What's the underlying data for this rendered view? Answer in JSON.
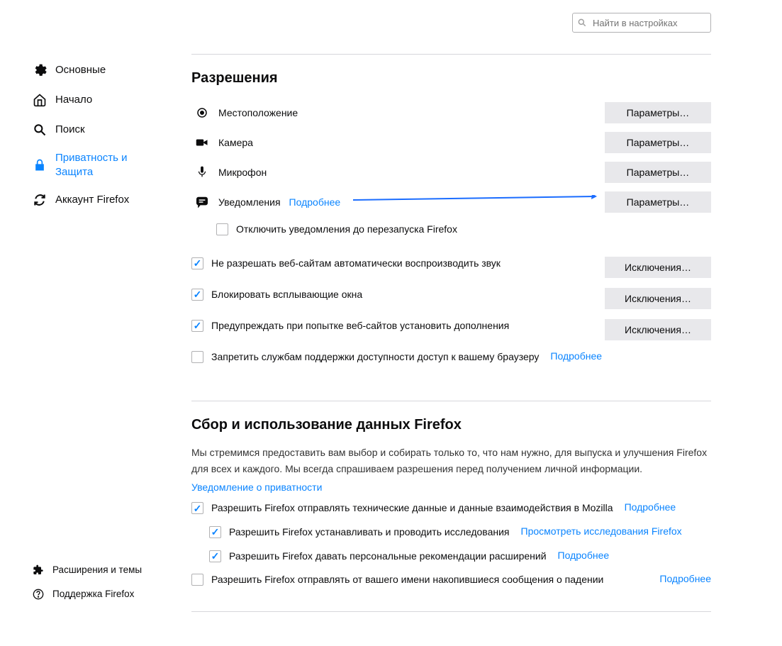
{
  "search": {
    "placeholder": "Найти в настройках"
  },
  "sidebar": {
    "items": [
      {
        "label": "Основные"
      },
      {
        "label": "Начало"
      },
      {
        "label": "Поиск"
      },
      {
        "label": "Приватность и Защита"
      },
      {
        "label": "Аккаунт Firefox"
      }
    ],
    "bottom": [
      {
        "label": "Расширения и темы"
      },
      {
        "label": "Поддержка Firefox"
      }
    ]
  },
  "permissions": {
    "title": "Разрешения",
    "location": {
      "label": "Местоположение",
      "button": "Параметры…"
    },
    "camera": {
      "label": "Камера",
      "button": "Параметры…"
    },
    "microphone": {
      "label": "Микрофон",
      "button": "Параметры…"
    },
    "notifications": {
      "label": "Уведомления",
      "more": "Подробнее",
      "button": "Параметры…",
      "disable": "Отключить уведомления до перезапуска Firefox"
    },
    "autoplay": {
      "label": "Не разрешать веб-сайтам автоматически воспроизводить звук",
      "button": "Исключения…"
    },
    "popups": {
      "label": "Блокировать всплывающие окна",
      "button": "Исключения…"
    },
    "addons": {
      "label": "Предупреждать при попытке веб-сайтов установить дополнения",
      "button": "Исключения…"
    },
    "a11y": {
      "label": "Запретить службам поддержки доступности доступ к вашему браузеру",
      "more": "Подробнее"
    }
  },
  "dataCollection": {
    "title": "Сбор и использование данных Firefox",
    "desc": "Мы стремимся предоставить вам выбор и собирать только то, что нам нужно, для выпуска и улучшения Firefox для всех и каждого. Мы всегда спрашиваем разрешения перед получением личной информации.",
    "privacyLink": "Уведомление о приватности",
    "tech": {
      "label": "Разрешить Firefox отправлять технические данные и данные взаимодействия в Mozilla",
      "more": "Подробнее"
    },
    "studies": {
      "label": "Разрешить Firefox устанавливать и проводить исследования",
      "link": "Просмотреть исследования Firefox"
    },
    "recs": {
      "label": "Разрешить Firefox давать персональные рекомендации расширений",
      "more": "Подробнее"
    },
    "crash": {
      "label": "Разрешить Firefox отправлять от вашего имени накопившиеся сообщения о падении",
      "more": "Подробнее"
    }
  }
}
